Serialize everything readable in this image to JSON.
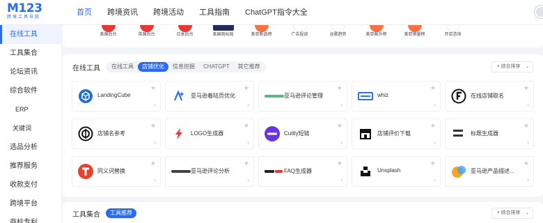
{
  "logo": {
    "mark": "M123",
    "sub": "跨境工具导航"
  },
  "nav": [
    {
      "label": "首页",
      "active": true
    },
    {
      "label": "跨境资讯"
    },
    {
      "label": "跨境活动"
    },
    {
      "label": "工具指南"
    },
    {
      "label": "ChatGPT指令大全"
    }
  ],
  "sidebar": [
    {
      "label": "在线工具",
      "active": true
    },
    {
      "label": "工具集合"
    },
    {
      "label": "论坛资讯"
    },
    {
      "label": "综合软件"
    },
    {
      "label": "ERP",
      "level": 1
    },
    {
      "label": "关键词",
      "level": 2
    },
    {
      "label": "选品分析"
    },
    {
      "label": "推荐服务"
    },
    {
      "label": "收款支付"
    },
    {
      "label": "跨境平台"
    },
    {
      "label": "商标专利"
    }
  ],
  "top_icons": [
    {
      "label": "美国后台",
      "color": "#e53935"
    },
    {
      "label": "英国后台",
      "color": "#e53935"
    },
    {
      "label": "日本后台",
      "color": "#e53935"
    },
    {
      "label": "美国商标局",
      "color": "#1f2d5a"
    },
    {
      "label": "美亚新品榜",
      "color": "#ff7043"
    },
    {
      "label": "广告投放",
      "color": "#ffffff"
    },
    {
      "label": "谷歌趋势",
      "color": "#ffffff"
    },
    {
      "label": "美亚飙升榜",
      "color": "#ff7043"
    },
    {
      "label": "美亚销量榜",
      "color": "#ff7043"
    },
    {
      "label": "开店咨询",
      "color": "#ffffff"
    }
  ],
  "online_tools": {
    "title": "在线工具",
    "tabs": [
      "在线工具",
      "店铺优化",
      "信息挖掘",
      "CHATGPT",
      "其它推荐"
    ],
    "active_tab": 1,
    "sort_label": "综合排序",
    "tools": [
      {
        "name": "LandingCube",
        "icon": "cube-icon",
        "color": "#1f6fd1"
      },
      {
        "name": "亚马逊着陆页优化",
        "icon": "spark-a-icon",
        "color": "#2b6bf3"
      },
      {
        "name": "亚马逊评论管理",
        "icon": "review-text-icon",
        "color": "#3aa36b"
      },
      {
        "name": "whiz",
        "icon": "whiz-icon",
        "color": "#2f6fe0"
      },
      {
        "name": "在线店铺取名",
        "icon": "f-circle-icon",
        "color": "#111111"
      },
      {
        "name": "店铺名参考",
        "icon": "ring-icon",
        "color": "#111111"
      },
      {
        "name": "LOGO生成器",
        "icon": "bolt-icon",
        "color": "#e53935"
      },
      {
        "name": "Cuttly短链",
        "icon": "cuttly-icon",
        "color": "#6a35e0"
      },
      {
        "name": "店铺评价下载",
        "icon": "store-icon",
        "color": "#111111"
      },
      {
        "name": "标题生成器",
        "icon": "title-text-icon",
        "color": "#333333"
      },
      {
        "name": "同义词替换",
        "icon": "t-logo-icon",
        "color": "#e5432d"
      },
      {
        "name": "亚马逊评论分析",
        "icon": "appbot-icon",
        "color": "#222222"
      },
      {
        "name": "FAQ生成器",
        "icon": "faq-icon",
        "color": "#e53935"
      },
      {
        "name": "Unsplash",
        "icon": "camera-icon",
        "color": "#111111"
      },
      {
        "name": "亚马逊产品描述...",
        "icon": "bubbles-icon",
        "color": "#f5a623"
      }
    ]
  },
  "tool_sets": {
    "title": "工具集合",
    "tab": "工具推荐",
    "sort_label": "综合排序"
  }
}
